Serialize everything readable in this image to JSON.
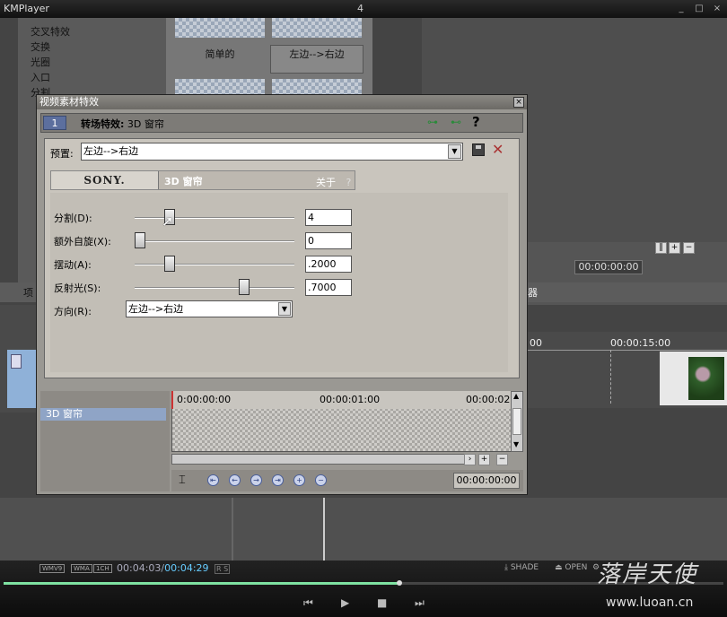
{
  "player": {
    "app_name": "KMPlayer",
    "window_number": "4",
    "window_buttons": [
      "_",
      "□",
      "×"
    ]
  },
  "background": {
    "transition_list": [
      "交叉特效",
      "交换",
      "光圈",
      "入口",
      "分割"
    ],
    "thumbnails": [
      "简单的",
      "左边-->右边"
    ],
    "timecode_top": "00:00:00:00",
    "timeline_ticks": [
      "00",
      "00:00:15:00"
    ],
    "left_tab": "项",
    "right_tab": "器"
  },
  "dialog": {
    "title": "视频素材特效",
    "close": "×",
    "step_number": "1",
    "head_label_prefix": "转场特效:",
    "head_label_name": "3D 窗帘",
    "help_icon": "?",
    "preset_label": "预置:",
    "preset_value": "左边-->右边",
    "plugin_brand": "SONY.",
    "plugin_name": "3D 窗帘",
    "about_label": "关于",
    "about_q": "?",
    "params": [
      {
        "label": "分割(D):",
        "value": "4",
        "fraction": 0.2
      },
      {
        "label": "额外自旋(X):",
        "value": "0",
        "fraction": 0.0
      },
      {
        "label": "摆动(A):",
        "value": ".2000",
        "fraction": 0.2
      },
      {
        "label": "反射光(S):",
        "value": ".7000",
        "fraction": 0.7
      }
    ],
    "direction_label": "方向(R):",
    "direction_value": "左边-->右边",
    "track_label": "3D 窗帘",
    "ruler": [
      "0:00:00:00",
      "00:00:01:00",
      "00:00:02"
    ],
    "timecode": "00:00:00:00"
  },
  "kmbar": {
    "badges": [
      "WMV9",
      "WMA",
      "1CH"
    ],
    "time_current": "00:04:03",
    "time_sep": "/",
    "time_total": "00:04:29",
    "rs": "R S",
    "shade": "SHADE",
    "open": "OPEN",
    "seek_fraction": 0.55
  },
  "watermark": {
    "text": "落岸天使",
    "url": "www.luoan.cn"
  }
}
